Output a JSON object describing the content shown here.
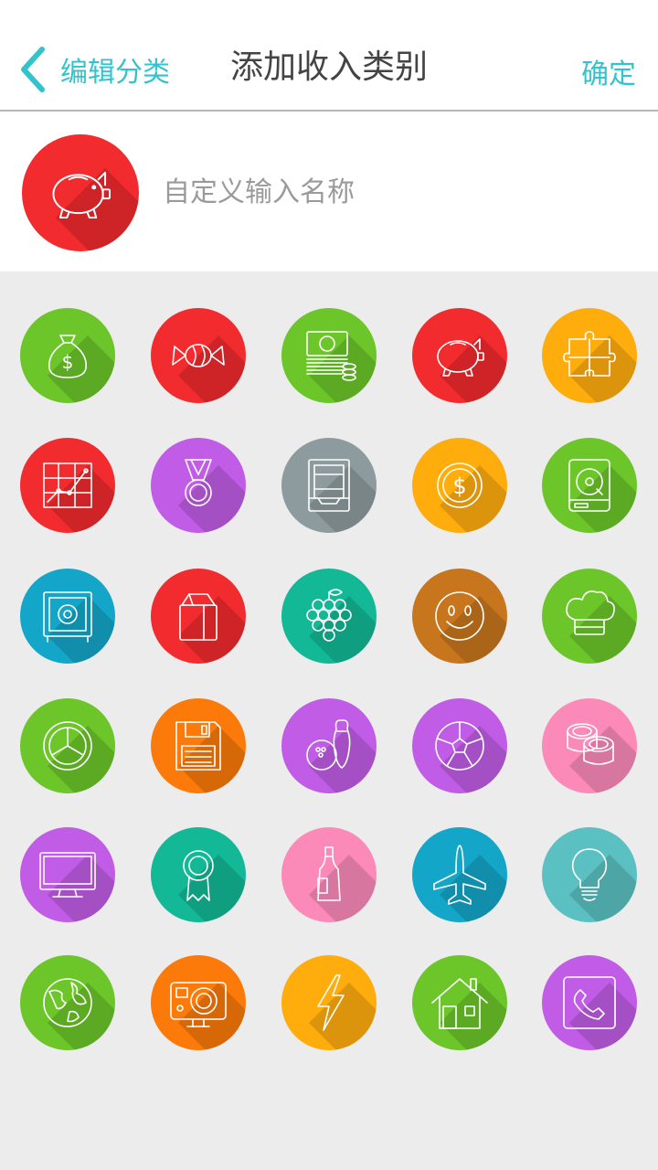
{
  "header": {
    "back_label": "编辑分类",
    "title": "添加收入类别",
    "confirm_label": "确定"
  },
  "name_field": {
    "placeholder": "自定义输入名称",
    "value": ""
  },
  "selected_icon": {
    "name": "piggy-bank-icon",
    "color": "#f22b2e"
  },
  "colors": {
    "accent": "#32c3cc"
  },
  "icons": [
    {
      "name": "money-bag-icon",
      "color": "#6cc629"
    },
    {
      "name": "candy-icon",
      "color": "#f22b2e"
    },
    {
      "name": "cash-stack-icon",
      "color": "#6cc629"
    },
    {
      "name": "piggy-bank-icon",
      "color": "#f22b2e"
    },
    {
      "name": "puzzle-icon",
      "color": "#ffad0d"
    },
    {
      "name": "stock-chart-icon",
      "color": "#f22b2e"
    },
    {
      "name": "medal-icon",
      "color": "#c05ce6"
    },
    {
      "name": "tray-icon",
      "color": "#8e9b9e"
    },
    {
      "name": "coin-icon",
      "color": "#ffad0d"
    },
    {
      "name": "hard-drive-icon",
      "color": "#6cc629"
    },
    {
      "name": "safe-icon",
      "color": "#14a6c8"
    },
    {
      "name": "bag-icon",
      "color": "#f22b2e"
    },
    {
      "name": "grapes-icon",
      "color": "#13b896"
    },
    {
      "name": "smiley-icon",
      "color": "#c7761e"
    },
    {
      "name": "chef-hat-icon",
      "color": "#6cc629"
    },
    {
      "name": "lime-slice-icon",
      "color": "#6cc629"
    },
    {
      "name": "floppy-disk-icon",
      "color": "#fb7a0a"
    },
    {
      "name": "bowling-icon",
      "color": "#c05ce6"
    },
    {
      "name": "soccer-ball-icon",
      "color": "#c05ce6"
    },
    {
      "name": "sushi-icon",
      "color": "#fb8ab8"
    },
    {
      "name": "monitor-icon",
      "color": "#c05ce6"
    },
    {
      "name": "award-ribbon-icon",
      "color": "#13b896"
    },
    {
      "name": "wine-bottle-icon",
      "color": "#fb8ab8"
    },
    {
      "name": "airplane-icon",
      "color": "#14a6c8"
    },
    {
      "name": "light-bulb-icon",
      "color": "#5bc0c2"
    },
    {
      "name": "globe-icon",
      "color": "#6cc629"
    },
    {
      "name": "action-camera-icon",
      "color": "#fb7a0a"
    },
    {
      "name": "lightning-icon",
      "color": "#ffad0d"
    },
    {
      "name": "house-icon",
      "color": "#6cc629"
    },
    {
      "name": "phone-icon",
      "color": "#c05ce6"
    }
  ]
}
